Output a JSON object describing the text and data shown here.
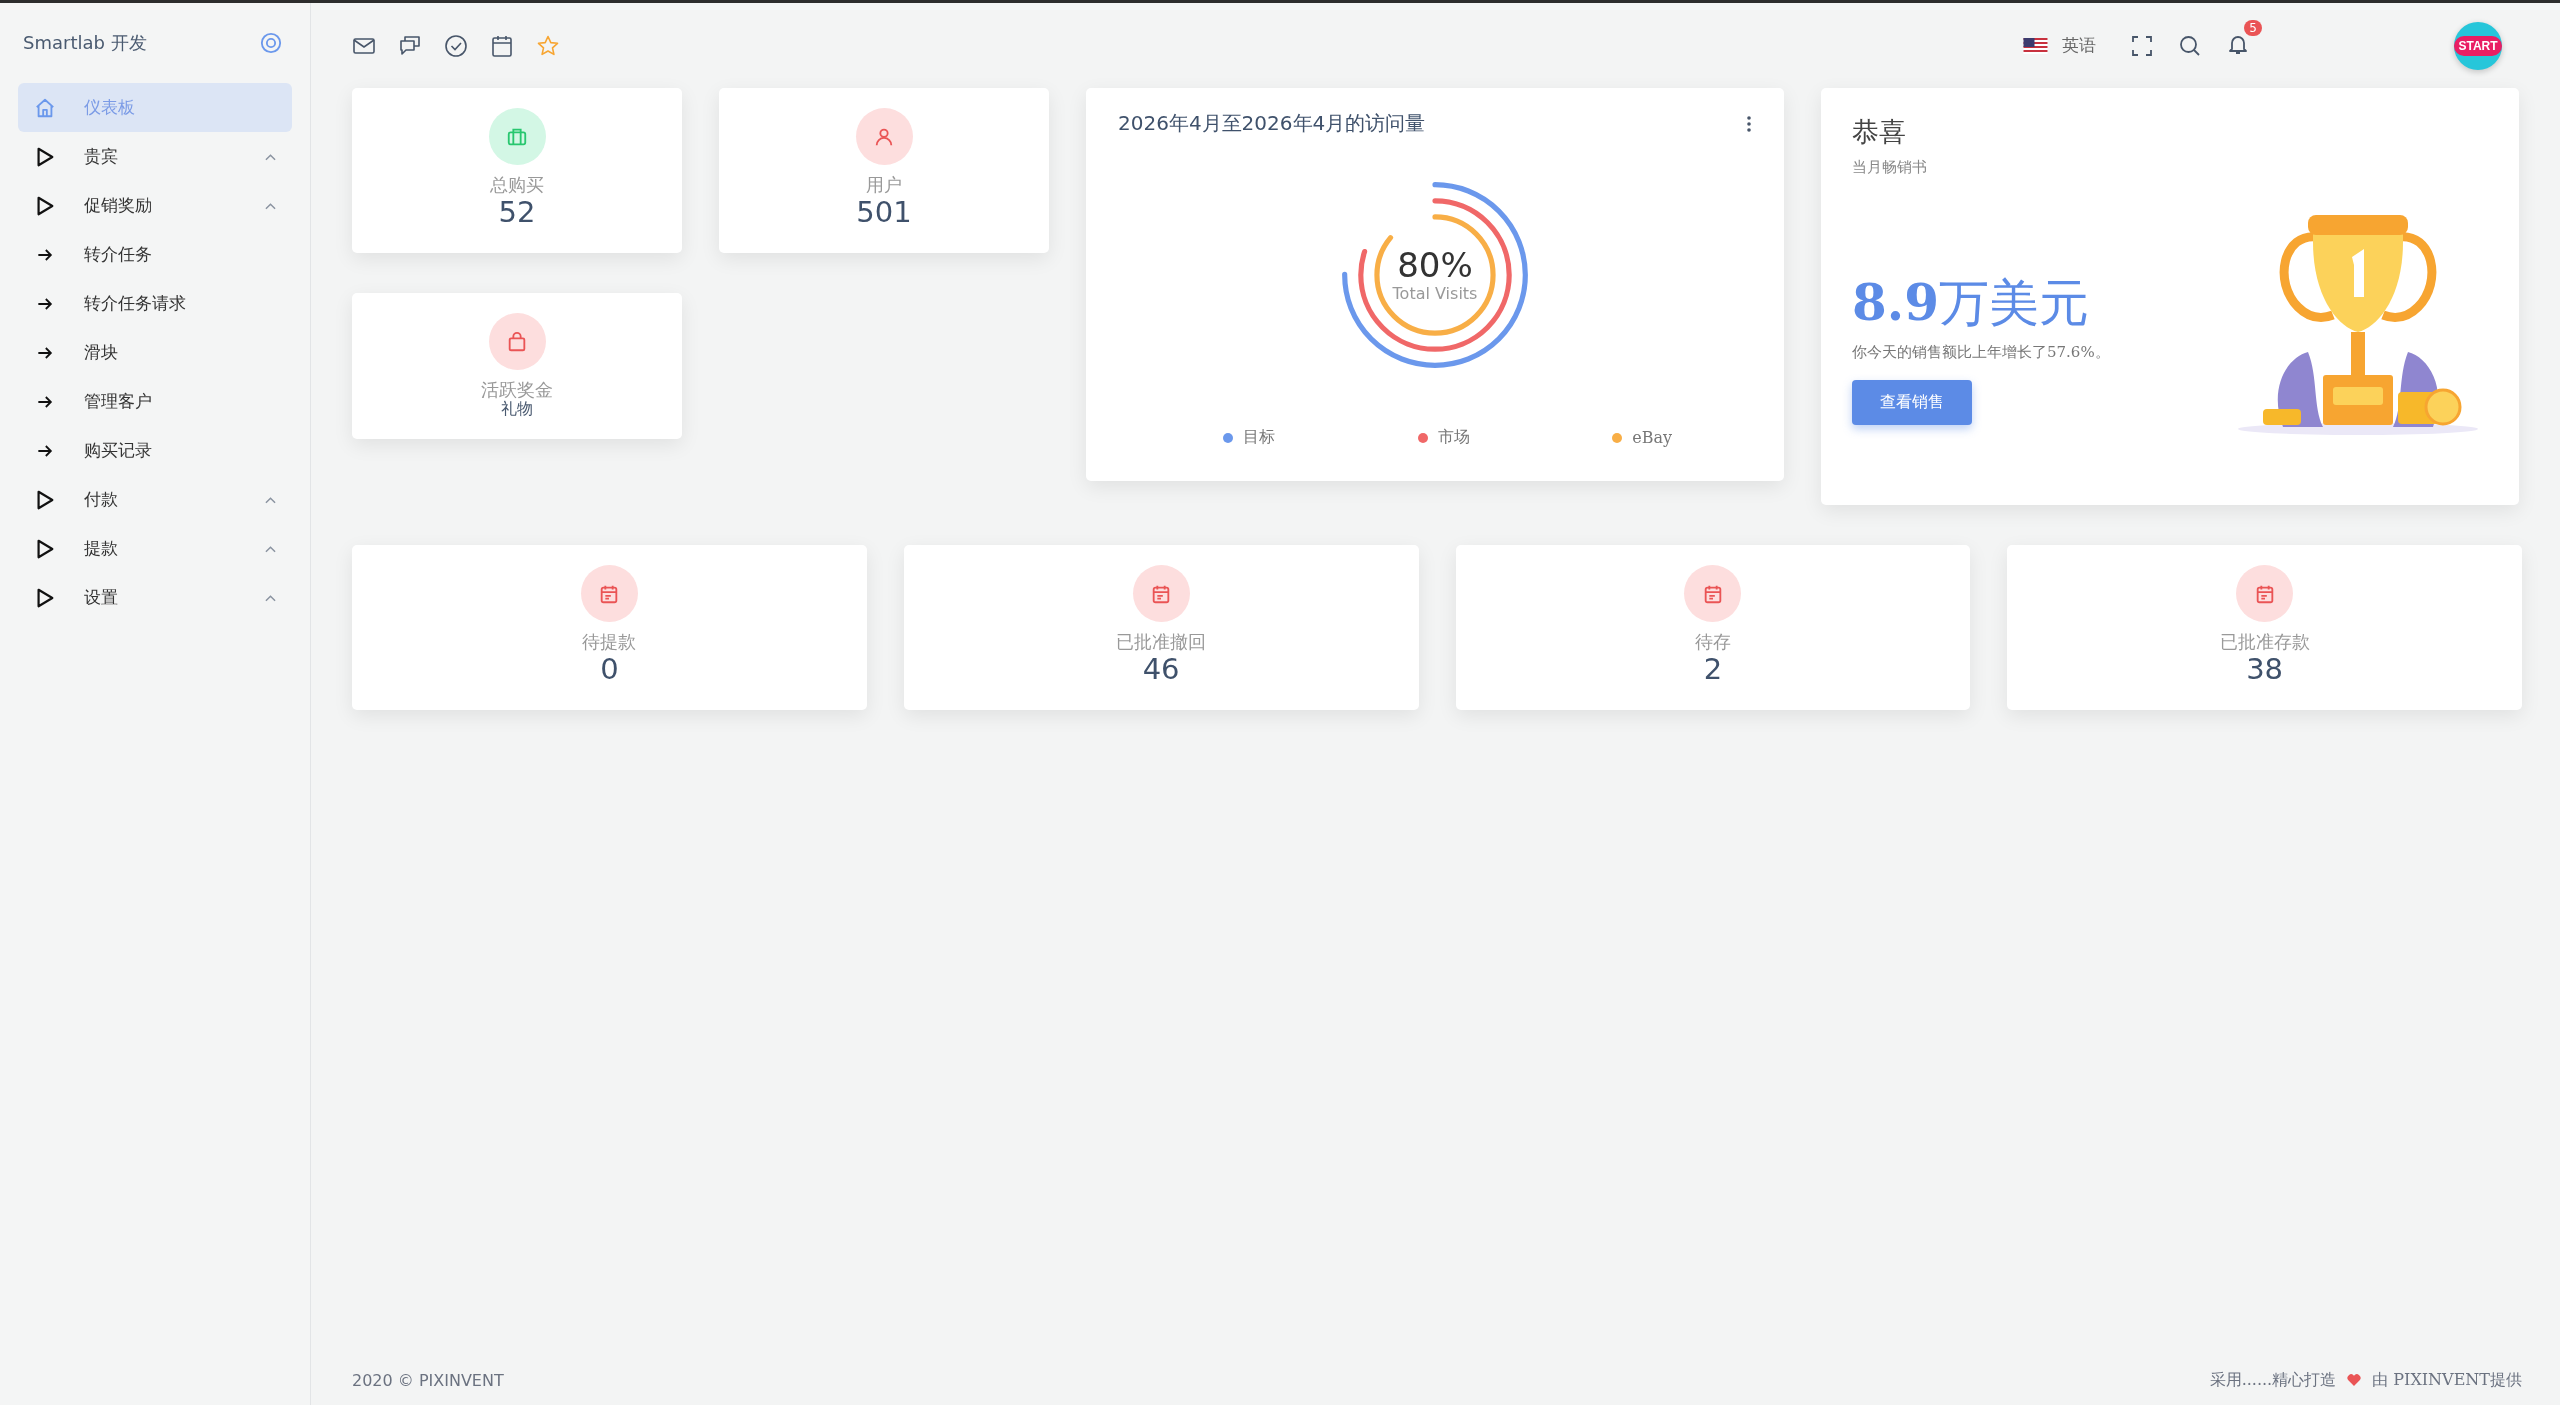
{
  "sidebar": {
    "brand": "Smartlab 开发",
    "items": [
      {
        "label": "仪表板",
        "kind": "home",
        "selected": true
      },
      {
        "label": "贵宾",
        "kind": "group",
        "selected": false
      },
      {
        "label": "促销奖励",
        "kind": "group",
        "selected": false,
        "children": [
          {
            "label": "转介任务",
            "kind": "link",
            "selected": false
          },
          {
            "label": "转介任务请求",
            "kind": "link",
            "selected": false
          },
          {
            "label": "滑块",
            "kind": "link",
            "selected": false
          },
          {
            "label": "管理客户",
            "kind": "link",
            "selected": false
          },
          {
            "label": "购买记录",
            "kind": "link",
            "selected": false
          }
        ]
      },
      {
        "label": "付款",
        "kind": "group",
        "selected": false
      },
      {
        "label": "提款",
        "kind": "group",
        "selected": false
      },
      {
        "label": "设置",
        "kind": "group",
        "selected": false
      }
    ]
  },
  "header": {
    "language": "英语",
    "notification_count": "5",
    "avatar_text": "START"
  },
  "stats_top": [
    {
      "label": "总购买",
      "value": "52",
      "kind": "number"
    },
    {
      "label": "用户",
      "value": "501",
      "kind": "number"
    },
    {
      "label": "活跃奖金",
      "value": "礼物",
      "kind": "text"
    }
  ],
  "visits": {
    "title": "2026年4月至2026年4月的访问量",
    "center_value": "80%",
    "center_label": "Total Visits",
    "legend": [
      {
        "label": "目标",
        "color": "#6b98ec"
      },
      {
        "label": "市场",
        "color": "#f06868"
      },
      {
        "label": "eBay",
        "color": "#f8ae46"
      }
    ]
  },
  "congrats": {
    "title": "恭喜",
    "subtitle": "当月畅销书",
    "amount": "**8.9**万美元",
    "description": "你今天的销售额比上年增长了57.6%。",
    "button": "查看销售"
  },
  "stats_bottom": [
    {
      "label": "待提款",
      "value": "0",
      "kind": "number"
    },
    {
      "label": "已批准撤回",
      "value": "46",
      "kind": "number"
    },
    {
      "label": "待存",
      "value": "2",
      "kind": "number"
    },
    {
      "label": "已批准存款",
      "value": "38",
      "kind": "number"
    }
  ],
  "footer": {
    "left": "2020 © PIXINVENT",
    "right_before": "采用......精心打造",
    "right_after": "由 PIXINVENT提供"
  }
}
